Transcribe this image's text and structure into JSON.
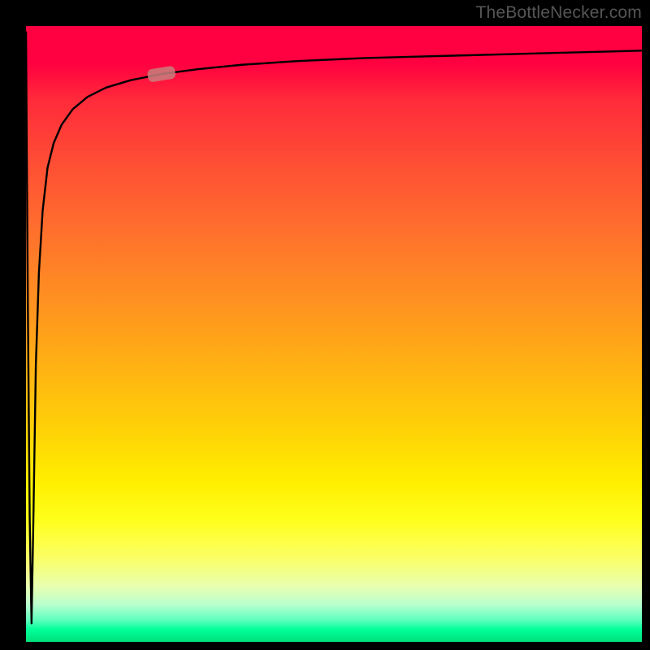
{
  "watermark": "TheBottleNecker.com",
  "colors": {
    "frame": "#000000",
    "curve": "#000000",
    "marker": "#c87f7d",
    "gradient_top": "#ff0040",
    "gradient_bottom": "#00e07a"
  },
  "chart_data": {
    "type": "line",
    "title": "",
    "xlabel": "",
    "ylabel": "",
    "xlim": [
      0,
      100
    ],
    "ylim": [
      0,
      100
    ],
    "grid": false,
    "legend": false,
    "annotations": [
      "TheBottleNecker.com"
    ],
    "background": "vertical gradient red→orange→yellow→green (top→bottom)",
    "x": [
      0,
      0.3,
      0.6,
      0.9,
      1.2,
      1.6,
      2.1,
      2.7,
      3.5,
      4.5,
      5.8,
      7.6,
      10,
      13,
      17,
      22,
      28,
      35,
      44,
      55,
      70,
      85,
      100
    ],
    "values": [
      99,
      55,
      20,
      3,
      20,
      45,
      60,
      70,
      77,
      81,
      84,
      86.5,
      88.5,
      90,
      91.2,
      92.2,
      93,
      93.7,
      94.3,
      94.8,
      95.2,
      95.6,
      96
    ],
    "marker_point": {
      "x": 22,
      "y": 92.2
    },
    "notes": "Curve starts at top-left, drops nearly vertically to a sharp minimum near x≈1 y≈3, then rises steeply and asymptotically approaches ~96 across the top. Axes have no visible tick labels; values are estimated on a 0–100 normalized scale. A single pale rounded marker sits on the curve near x≈22."
  }
}
